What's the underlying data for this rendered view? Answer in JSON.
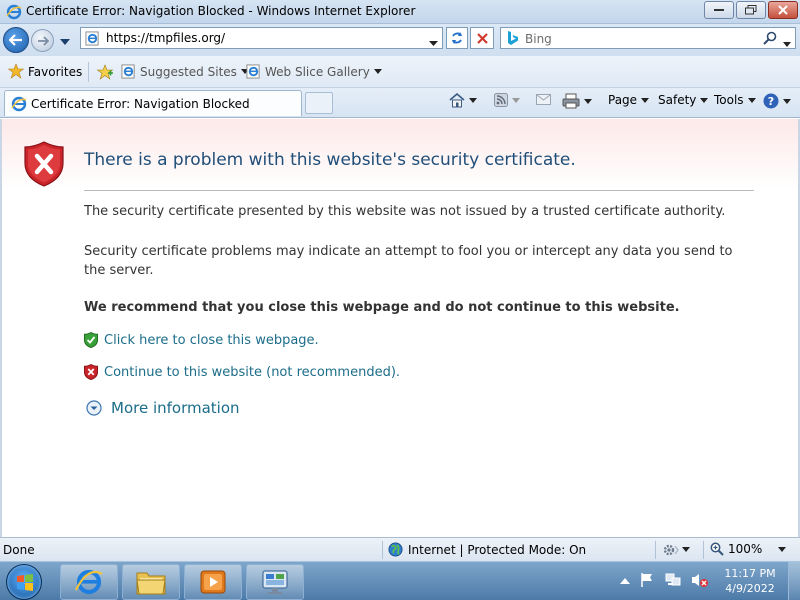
{
  "window": {
    "title": "Certificate Error: Navigation Blocked - Windows Internet Explorer"
  },
  "address_bar": {
    "url": "https://tmpfiles.org/"
  },
  "search": {
    "placeholder": "Bing"
  },
  "favorites_bar": {
    "favorites_label": "Favorites",
    "suggested_sites_label": "Suggested Sites",
    "web_slice_gallery_label": "Web Slice Gallery"
  },
  "tab": {
    "title": "Certificate Error: Navigation Blocked"
  },
  "command_bar": {
    "page_label": "Page",
    "safety_label": "Safety",
    "tools_label": "Tools"
  },
  "content": {
    "headline": "There is a problem with this website's security certificate.",
    "paragraph1": "The security certificate presented by this website was not issued by a trusted certificate authority.",
    "paragraph2": "Security certificate problems may indicate an attempt to fool you or intercept any data you send to the server.",
    "recommendation": "We recommend that you close this webpage and do not continue to this website.",
    "close_link": "Click here to close this webpage.",
    "continue_link": "Continue to this website (not recommended).",
    "more_info": "More information"
  },
  "status_bar": {
    "status": "Done",
    "zone": "Internet | Protected Mode: On",
    "zoom": "100%"
  },
  "taskbar": {
    "time": "11:17 PM",
    "date": "4/9/2022"
  }
}
